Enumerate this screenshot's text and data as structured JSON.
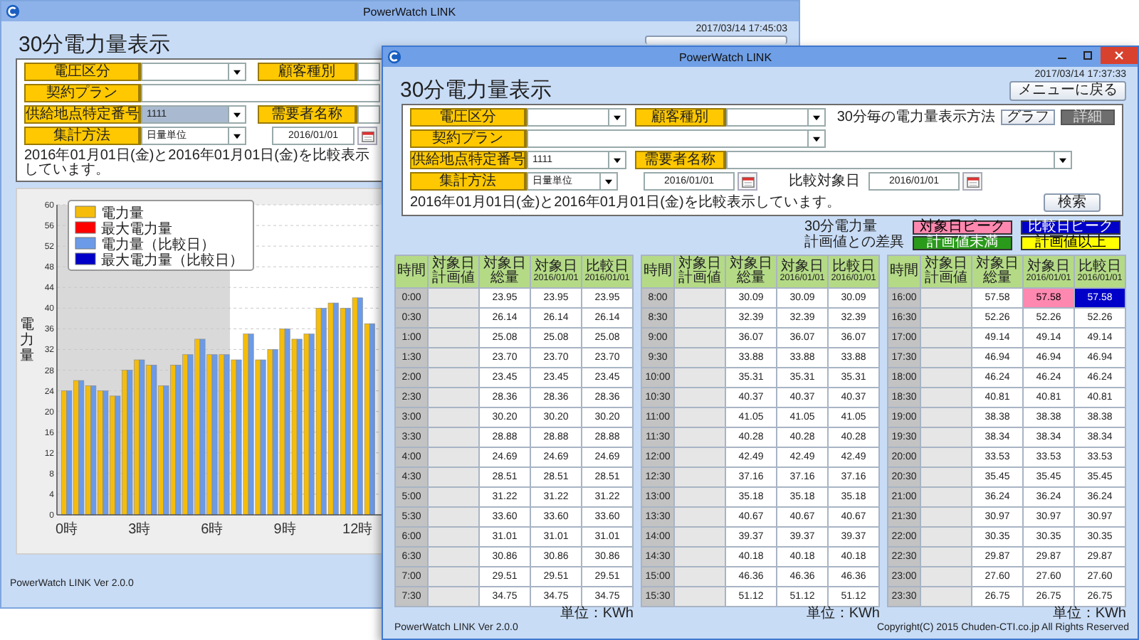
{
  "back_window": {
    "title": "PowerWatch LINK",
    "timestamp": "2017/03/14 17:45:03",
    "heading": "30分電力量表示",
    "form_rows": [
      [
        {
          "label": "電圧区分",
          "kind": "select",
          "disabled": false
        },
        {
          "label": "顧客種別",
          "kind": "input",
          "disabled": false
        }
      ],
      [
        {
          "label": "契約プラン",
          "kind": "input",
          "disabled": false
        }
      ],
      [
        {
          "label": "供給地点特定番号",
          "kind": "select",
          "value": "1111",
          "disabled": true
        },
        {
          "label": "需要者名称",
          "kind": "input",
          "disabled": false
        }
      ],
      [
        {
          "label": "集計方法",
          "kind": "select",
          "value": "日量単位",
          "disabled": false
        },
        {
          "kind": "date",
          "value": "2016/01/01"
        }
      ]
    ],
    "note": "2016年01月01日(金)と2016年01月01日(金)を比較表示しています。",
    "chart_data": {
      "type": "bar",
      "ylabel": "電力量",
      "x": [
        0,
        0.5,
        1,
        1.5,
        2,
        2.5,
        3,
        3.5,
        4,
        4.5,
        5,
        5.5,
        6,
        6.5,
        7,
        7.5,
        8,
        8.5,
        9,
        9.5,
        10,
        10.5,
        11,
        11.5,
        12,
        12.5
      ],
      "series": [
        {
          "name": "電力量",
          "color": "#f5bd0a",
          "values": [
            24,
            26,
            25,
            24,
            23,
            28,
            30,
            29,
            25,
            29,
            31,
            34,
            31,
            31,
            30,
            35,
            30,
            32,
            36,
            34,
            35,
            40,
            41,
            40,
            42,
            37
          ]
        },
        {
          "name": "最大電力量",
          "color": "#ff0000",
          "values": [
            null,
            null,
            null,
            null,
            null,
            null,
            null,
            null,
            null,
            null,
            null,
            null,
            null,
            null,
            null,
            null,
            null,
            null,
            null,
            null,
            null,
            null,
            null,
            null,
            null,
            null
          ]
        },
        {
          "name": "電力量（比較日）",
          "color": "#6b9be8",
          "values": [
            24,
            26,
            25,
            24,
            23,
            28,
            30,
            29,
            25,
            29,
            31,
            34,
            31,
            31,
            30,
            35,
            30,
            32,
            36,
            34,
            35,
            40,
            41,
            40,
            42,
            37
          ]
        },
        {
          "name": "最大電力量（比較日）",
          "color": "#0000c8",
          "values": [
            null,
            null,
            null,
            null,
            null,
            null,
            null,
            null,
            null,
            null,
            null,
            null,
            null,
            null,
            null,
            null,
            null,
            null,
            null,
            null,
            null,
            null,
            null,
            null,
            null,
            null
          ]
        }
      ],
      "xlim": [
        -0.4,
        13.05
      ],
      "ylim": [
        0,
        60
      ],
      "grid": true,
      "legend": true,
      "yticks": [
        0,
        4,
        8,
        12,
        16,
        20,
        24,
        28,
        32,
        36,
        40,
        44,
        48,
        52,
        56,
        60
      ],
      "xticks": [
        {
          "value": 0,
          "label": "0時"
        },
        {
          "value": 3,
          "label": "3時"
        },
        {
          "value": 6,
          "label": "6時"
        },
        {
          "value": 9,
          "label": "9時"
        },
        {
          "value": 12,
          "label": "12時"
        }
      ]
    },
    "footer": "PowerWatch LINK Ver 2.0.0"
  },
  "front_window": {
    "title": "PowerWatch LINK",
    "timestamp": "2017/03/14 17:37:33",
    "heading": "30分電力量表示",
    "menu_button": "メニューに戻る",
    "form_rows": [
      [
        {
          "label": "電圧区分",
          "kind": "select",
          "disabled": false
        },
        {
          "label": "顧客種別",
          "kind": "select",
          "disabled": false
        }
      ],
      [
        {
          "label": "契約プラン",
          "kind": "select",
          "disabled": false
        }
      ],
      [
        {
          "label": "供給地点特定番号",
          "kind": "select",
          "value": "1111",
          "disabled": false
        },
        {
          "label": "需要者名称",
          "kind": "select",
          "disabled": false
        }
      ],
      [
        {
          "label": "集計方法",
          "kind": "select",
          "value": "日量単位",
          "disabled": false
        },
        {
          "kind": "date",
          "value": "2016/01/01"
        },
        {
          "caption": "比較対象日",
          "kind": "date",
          "value": "2016/01/01"
        }
      ]
    ],
    "display_method": {
      "label": "30分毎の電力量表示方法",
      "buttons": [
        {
          "label": "グラフ",
          "selected": false
        },
        {
          "label": "詳細",
          "selected": true
        }
      ]
    },
    "note": "2016年01月01日(金)と2016年01月01日(金)を比較表示しています。",
    "search_button": "検索",
    "legend": [
      {
        "title": "30分電力量",
        "items": [
          {
            "label": "対象日ピーク",
            "color": "#ff88b0"
          },
          {
            "label": "比較日ピーク",
            "color": "#0000c8"
          }
        ]
      },
      {
        "title": "計画値との差異",
        "items": [
          {
            "label": "計画値未満",
            "color": "#2a9a1a"
          },
          {
            "label": "計画値以上",
            "color": "#ffff00"
          }
        ]
      }
    ],
    "tables": [
      {
        "columns": [
          "時間",
          "対象日計画値",
          "対象日総量",
          "対象日\n2016/01/01",
          "比較日\n2016/01/01"
        ],
        "unit": "単位：KWh",
        "rows": [
          {
            "time": "0:00",
            "total": "23.95",
            "target": "23.95",
            "compare": "23.95",
            "target_peak": false,
            "compare_peak": false
          },
          {
            "time": "0:30",
            "total": "26.14",
            "target": "26.14",
            "compare": "26.14",
            "target_peak": false,
            "compare_peak": false
          },
          {
            "time": "1:00",
            "total": "25.08",
            "target": "25.08",
            "compare": "25.08",
            "target_peak": false,
            "compare_peak": false
          },
          {
            "time": "1:30",
            "total": "23.70",
            "target": "23.70",
            "compare": "23.70",
            "target_peak": false,
            "compare_peak": false
          },
          {
            "time": "2:00",
            "total": "23.45",
            "target": "23.45",
            "compare": "23.45",
            "target_peak": false,
            "compare_peak": false
          },
          {
            "time": "2:30",
            "total": "28.36",
            "target": "28.36",
            "compare": "28.36",
            "target_peak": false,
            "compare_peak": false
          },
          {
            "time": "3:00",
            "total": "30.20",
            "target": "30.20",
            "compare": "30.20",
            "target_peak": false,
            "compare_peak": false
          },
          {
            "time": "3:30",
            "total": "28.88",
            "target": "28.88",
            "compare": "28.88",
            "target_peak": false,
            "compare_peak": false
          },
          {
            "time": "4:00",
            "total": "24.69",
            "target": "24.69",
            "compare": "24.69",
            "target_peak": false,
            "compare_peak": false
          },
          {
            "time": "4:30",
            "total": "28.51",
            "target": "28.51",
            "compare": "28.51",
            "target_peak": false,
            "compare_peak": false
          },
          {
            "time": "5:00",
            "total": "31.22",
            "target": "31.22",
            "compare": "31.22",
            "target_peak": false,
            "compare_peak": false
          },
          {
            "time": "5:30",
            "total": "33.60",
            "target": "33.60",
            "compare": "33.60",
            "target_peak": false,
            "compare_peak": false
          },
          {
            "time": "6:00",
            "total": "31.01",
            "target": "31.01",
            "compare": "31.01",
            "target_peak": false,
            "compare_peak": false
          },
          {
            "time": "6:30",
            "total": "30.86",
            "target": "30.86",
            "compare": "30.86",
            "target_peak": false,
            "compare_peak": false
          },
          {
            "time": "7:00",
            "total": "29.51",
            "target": "29.51",
            "compare": "29.51",
            "target_peak": false,
            "compare_peak": false
          },
          {
            "time": "7:30",
            "total": "34.75",
            "target": "34.75",
            "compare": "34.75",
            "target_peak": false,
            "compare_peak": false
          }
        ]
      },
      {
        "columns": [
          "時間",
          "対象日計画値",
          "対象日総量",
          "対象日\n2016/01/01",
          "比較日\n2016/01/01"
        ],
        "unit": "単位：KWh",
        "rows": [
          {
            "time": "8:00",
            "total": "30.09",
            "target": "30.09",
            "compare": "30.09",
            "target_peak": false,
            "compare_peak": false
          },
          {
            "time": "8:30",
            "total": "32.39",
            "target": "32.39",
            "compare": "32.39",
            "target_peak": false,
            "compare_peak": false
          },
          {
            "time": "9:00",
            "total": "36.07",
            "target": "36.07",
            "compare": "36.07",
            "target_peak": false,
            "compare_peak": false
          },
          {
            "time": "9:30",
            "total": "33.88",
            "target": "33.88",
            "compare": "33.88",
            "target_peak": false,
            "compare_peak": false
          },
          {
            "time": "10:00",
            "total": "35.31",
            "target": "35.31",
            "compare": "35.31",
            "target_peak": false,
            "compare_peak": false
          },
          {
            "time": "10:30",
            "total": "40.37",
            "target": "40.37",
            "compare": "40.37",
            "target_peak": false,
            "compare_peak": false
          },
          {
            "time": "11:00",
            "total": "41.05",
            "target": "41.05",
            "compare": "41.05",
            "target_peak": false,
            "compare_peak": false
          },
          {
            "time": "11:30",
            "total": "40.28",
            "target": "40.28",
            "compare": "40.28",
            "target_peak": false,
            "compare_peak": false
          },
          {
            "time": "12:00",
            "total": "42.49",
            "target": "42.49",
            "compare": "42.49",
            "target_peak": false,
            "compare_peak": false
          },
          {
            "time": "12:30",
            "total": "37.16",
            "target": "37.16",
            "compare": "37.16",
            "target_peak": false,
            "compare_peak": false
          },
          {
            "time": "13:00",
            "total": "35.18",
            "target": "35.18",
            "compare": "35.18",
            "target_peak": false,
            "compare_peak": false
          },
          {
            "time": "13:30",
            "total": "40.67",
            "target": "40.67",
            "compare": "40.67",
            "target_peak": false,
            "compare_peak": false
          },
          {
            "time": "14:00",
            "total": "39.37",
            "target": "39.37",
            "compare": "39.37",
            "target_peak": false,
            "compare_peak": false
          },
          {
            "time": "14:30",
            "total": "40.18",
            "target": "40.18",
            "compare": "40.18",
            "target_peak": false,
            "compare_peak": false
          },
          {
            "time": "15:00",
            "total": "46.36",
            "target": "46.36",
            "compare": "46.36",
            "target_peak": false,
            "compare_peak": false
          },
          {
            "time": "15:30",
            "total": "51.12",
            "target": "51.12",
            "compare": "51.12",
            "target_peak": false,
            "compare_peak": false
          }
        ]
      },
      {
        "columns": [
          "時間",
          "対象日計画値",
          "対象日総量",
          "対象日\n2016/01/01",
          "比較日\n2016/01/01"
        ],
        "unit": "単位：KWh",
        "rows": [
          {
            "time": "16:00",
            "total": "57.58",
            "target": "57.58",
            "compare": "57.58",
            "target_peak": true,
            "compare_peak": true
          },
          {
            "time": "16:30",
            "total": "52.26",
            "target": "52.26",
            "compare": "52.26",
            "target_peak": false,
            "compare_peak": false
          },
          {
            "time": "17:00",
            "total": "49.14",
            "target": "49.14",
            "compare": "49.14",
            "target_peak": false,
            "compare_peak": false
          },
          {
            "time": "17:30",
            "total": "46.94",
            "target": "46.94",
            "compare": "46.94",
            "target_peak": false,
            "compare_peak": false
          },
          {
            "time": "18:00",
            "total": "46.24",
            "target": "46.24",
            "compare": "46.24",
            "target_peak": false,
            "compare_peak": false
          },
          {
            "time": "18:30",
            "total": "40.81",
            "target": "40.81",
            "compare": "40.81",
            "target_peak": false,
            "compare_peak": false
          },
          {
            "time": "19:00",
            "total": "38.38",
            "target": "38.38",
            "compare": "38.38",
            "target_peak": false,
            "compare_peak": false
          },
          {
            "time": "19:30",
            "total": "38.34",
            "target": "38.34",
            "compare": "38.34",
            "target_peak": false,
            "compare_peak": false
          },
          {
            "time": "20:00",
            "total": "33.53",
            "target": "33.53",
            "compare": "33.53",
            "target_peak": false,
            "compare_peak": false
          },
          {
            "time": "20:30",
            "total": "35.45",
            "target": "35.45",
            "compare": "35.45",
            "target_peak": false,
            "compare_peak": false
          },
          {
            "time": "21:00",
            "total": "36.24",
            "target": "36.24",
            "compare": "36.24",
            "target_peak": false,
            "compare_peak": false
          },
          {
            "time": "21:30",
            "total": "30.97",
            "target": "30.97",
            "compare": "30.97",
            "target_peak": false,
            "compare_peak": false
          },
          {
            "time": "22:00",
            "total": "30.35",
            "target": "30.35",
            "compare": "30.35",
            "target_peak": false,
            "compare_peak": false
          },
          {
            "time": "22:30",
            "total": "29.87",
            "target": "29.87",
            "compare": "29.87",
            "target_peak": false,
            "compare_peak": false
          },
          {
            "time": "23:00",
            "total": "27.60",
            "target": "27.60",
            "compare": "27.60",
            "target_peak": false,
            "compare_peak": false
          },
          {
            "time": "23:30",
            "total": "26.75",
            "target": "26.75",
            "compare": "26.75",
            "target_peak": false,
            "compare_peak": false
          }
        ]
      }
    ],
    "version": "PowerWatch LINK Ver 2.0.0",
    "copyright": "Copyright(C) 2015 Chuden-CTI.co.jp All Rights Reserved"
  }
}
